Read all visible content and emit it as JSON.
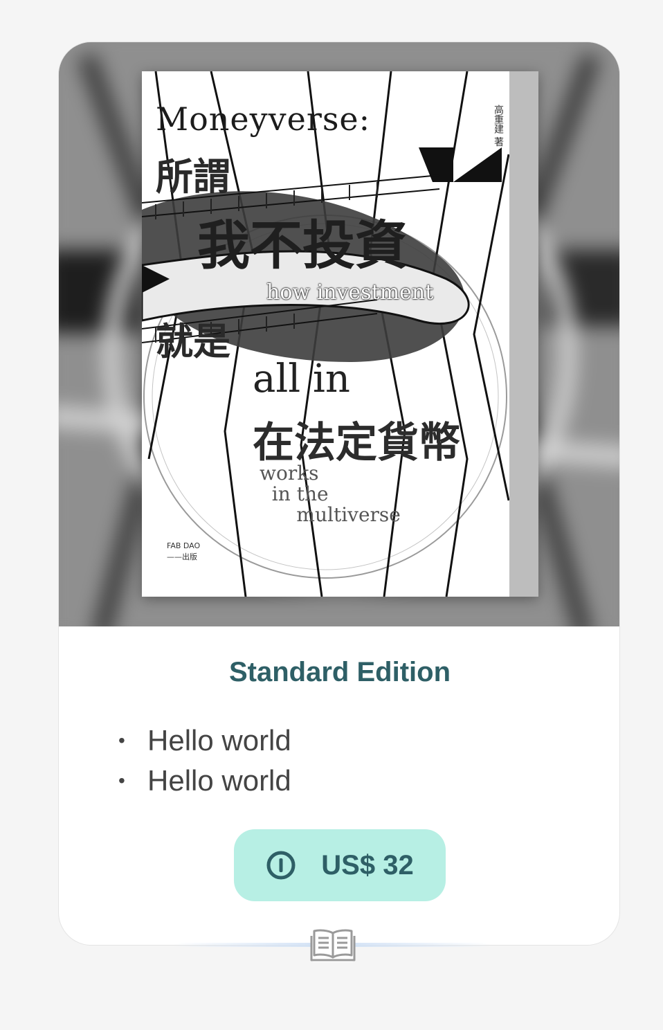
{
  "product": {
    "cover": {
      "title_en": "Moneyverse:",
      "title_cjk_1": "所謂",
      "title_cjk_2": "我不投資",
      "subtitle_en_1": "how investment",
      "title_cjk_3": "就是",
      "subtitle_en_2": "all in",
      "title_cjk_4": "在法定貨幣",
      "subtitle_en_3": "works\n  in the\n      multiverse",
      "publisher": "FAB DAO\n——出版",
      "author": "高重建 著"
    },
    "edition_title": "Standard Edition",
    "features": [
      "Hello world",
      "Hello world"
    ],
    "price_label": "US$ 32",
    "price_icon": "coin-icon",
    "footer_icon": "book-open-icon"
  },
  "colors": {
    "title": "#2e5f66",
    "price_bg": "#b7efe4",
    "card_bg": "#ffffff",
    "page_bg": "#f5f5f5"
  }
}
